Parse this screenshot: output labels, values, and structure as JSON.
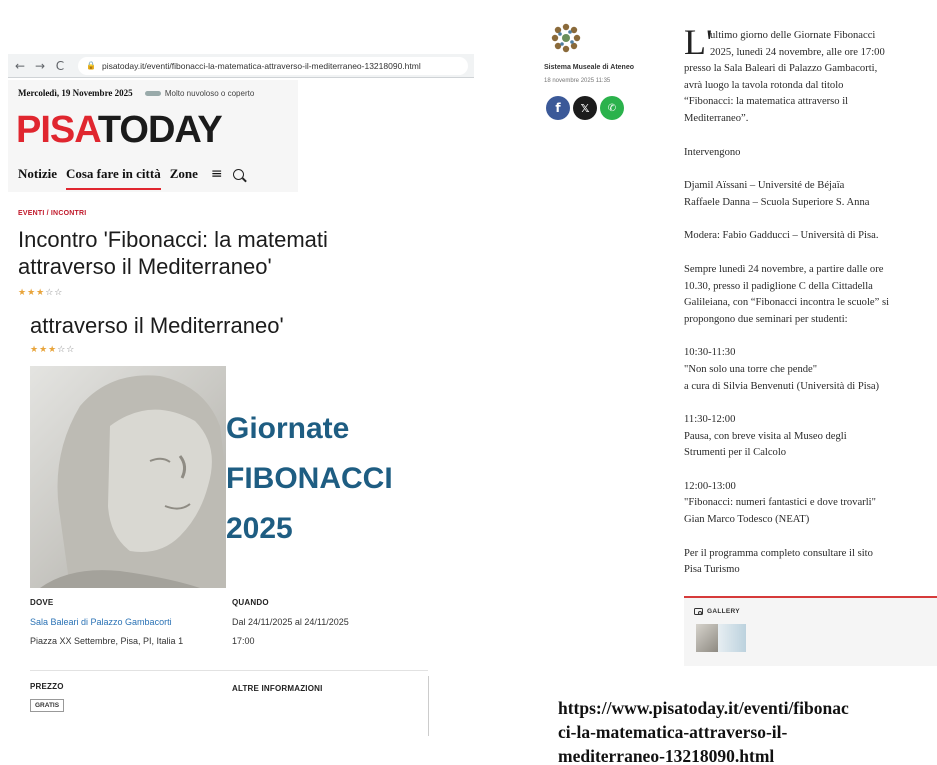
{
  "browser": {
    "back_icon": "←",
    "forward_icon": "→",
    "reload_icon": "C",
    "lock_icon": "🔒",
    "url": "pisatoday.it/eventi/fibonacci-la-matematica-attraverso-il-mediterraneo-13218090.html"
  },
  "site": {
    "date": "Mercoledì, 19 Novembre 2025",
    "weather": "Molto nuvoloso o coperto",
    "logo_pisa": "PISA",
    "logo_today": "TODAY",
    "nav": [
      "Notizie",
      "Cosa fare in città",
      "Zone"
    ],
    "menu_icon": "≡",
    "colors": {
      "brand_red": "#e0262f",
      "link_blue": "#2a72b5",
      "hero_blue": "#1e5d82"
    }
  },
  "event": {
    "category": "EVENTI / INCONTRI",
    "title_line1": "Incontro 'Fibonacci: la matemati",
    "title_line2": "attraverso il Mediterraneo'",
    "title_repeat": "attraverso il Mediterraneo'",
    "rating": 3,
    "rating_max": 5,
    "stars_on": "★★★",
    "stars_off": "☆☆",
    "hero_line1": "Giornate",
    "hero_line2": "FIBONACCI",
    "hero_line3": "2025",
    "dove_label": "DOVE",
    "dove_venue": "Sala Baleari di Palazzo Gambacorti",
    "dove_address": "Piazza XX Settembre, Pisa, PI, Italia 1",
    "quando_label": "QUANDO",
    "quando_dates": "Dal 24/11/2025 al 24/11/2025",
    "quando_time": "17:00",
    "prezzo_label": "PREZZO",
    "prezzo_value": "GRATIS",
    "altre_label": "ALTRE INFORMAZIONI"
  },
  "author": {
    "name": "Sistema Museale di Ateneo",
    "date": "18 novembre 2025 11:35",
    "facebook_icon": "f",
    "x_icon": "𝕏",
    "whatsapp_icon": "✆"
  },
  "article": {
    "dropcap": "L'",
    "p1": [
      "ultimo giorno delle Giornate Fibonacci",
      "2025, lunedì 24 novembre, alle ore 17:00"
    ],
    "p1_rest": [
      "presso la Sala Baleari di Palazzo Gambacorti,",
      "avrà luogo la tavola rotonda dal titolo",
      "“Fibonacci: la matematica attraverso il",
      "Mediterraneo”."
    ],
    "p2": "Intervengono",
    "p3": [
      "Djamil Aïssani – Université de Béjaïa",
      "Raffaele Danna – Scuola Superiore S. Anna"
    ],
    "p4": "Modera: Fabio Gadducci – Università di Pisa.",
    "p5": [
      "Sempre lunedì 24 novembre, a partire dalle ore",
      "10.30, presso il padiglione C della Cittadella",
      "Galileiana, con “Fibonacci incontra le scuole” si",
      "propongono due seminari per studenti:"
    ],
    "s1": [
      "10:30-11:30",
      "\"Non solo una torre che pende\"",
      "a cura di Silvia Benvenuti (Università di Pisa)"
    ],
    "s2": [
      "11:30-12:00",
      "Pausa, con breve visita al Museo degli",
      "Strumenti per il Calcolo"
    ],
    "s3": [
      "12:00-13:00",
      "\"Fibonacci: numeri fantastici e dove trovarli\"",
      "Gian Marco Todesco (NEAT)"
    ],
    "p6": [
      "Per il programma completo consultare il sito",
      "Pisa Turismo"
    ],
    "gallery_label": "GALLERY"
  },
  "caption": {
    "line1": "https://www.pisatoday.it/eventi/fibonac",
    "line2": "ci-la-matematica-attraverso-il-",
    "line3": "mediterraneo-13218090.html"
  }
}
